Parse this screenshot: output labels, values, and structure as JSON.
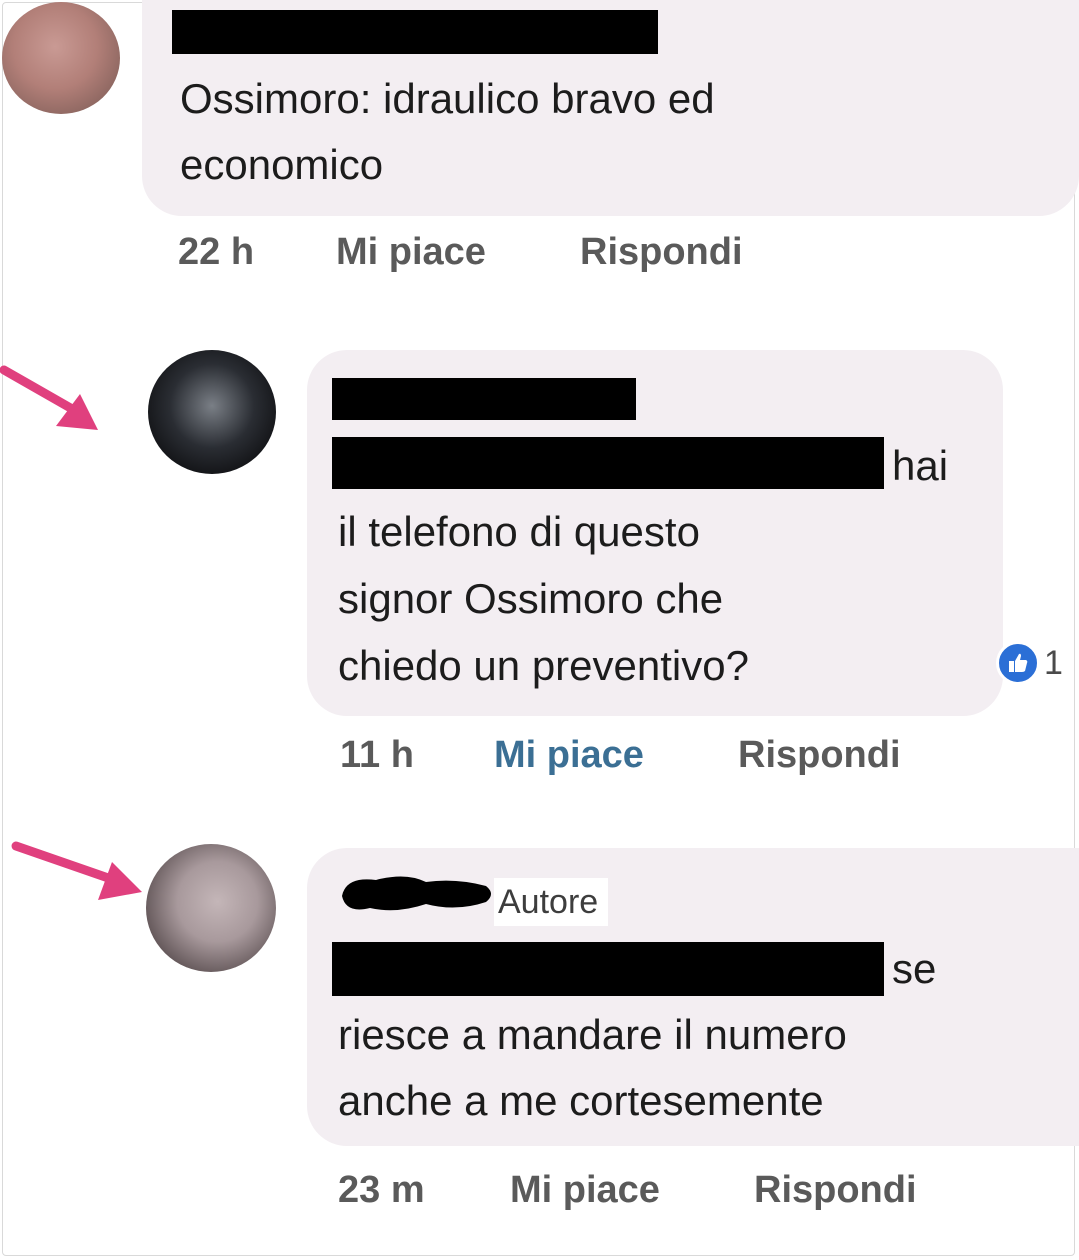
{
  "comments": [
    {
      "text_lines": [
        "Ossimoro: idraulico bravo ed",
        "economico"
      ],
      "time": "22 h",
      "like_label": "Mi piace",
      "reply_label": "Rispondi"
    },
    {
      "text_lines": [
        "hai",
        "il telefono di questo",
        "signor Ossimoro che",
        "chiedo un preventivo?"
      ],
      "time": "11 h",
      "like_label": "Mi piace",
      "reply_label": "Rispondi",
      "reaction": {
        "icon": "thumbs-up-icon",
        "count": "1",
        "color": "#2b6fd6"
      },
      "liked": true
    },
    {
      "author_badge": "Autore",
      "text_lines": [
        "se",
        "riesce a mandare il numero",
        "anche a me cortesemente"
      ],
      "time": "23 m",
      "like_label": "Mi piace",
      "reply_label": "Rispondi"
    }
  ],
  "colors": {
    "bubble": "#f3eef2",
    "liked_blue": "#3b6f94",
    "arrow_pink": "#e0407e",
    "redaction": "#000000"
  }
}
